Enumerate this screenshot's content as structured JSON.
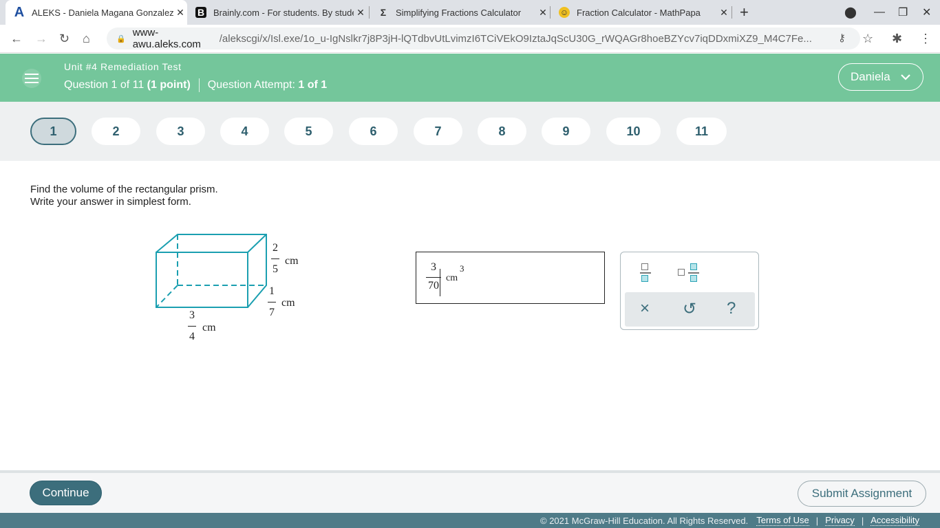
{
  "browser": {
    "tabs": [
      {
        "title": "ALEKS - Daniela Magana Gonzalez",
        "icon": "A",
        "active": true
      },
      {
        "title": "Brainly.com - For students. By students",
        "icon": "B"
      },
      {
        "title": "Simplifying Fractions Calculator",
        "icon": "Σ"
      },
      {
        "title": "Fraction Calculator - MathPapa",
        "icon": "☺"
      }
    ],
    "url_host": "www-awu.aleks.com",
    "url_path": "/alekscgi/x/Isl.exe/1o_u-IgNslkr7j8P3jH-lQTdbvUtLvimzI6TCiVEkO9IztaJqScU30G_rWQAGr8hoeBZYcv7iqDDxmiXZ9_M4C7Fe..."
  },
  "header": {
    "title": "Unit #4 Remediation Test",
    "question_prefix": "Question 1 of 11 ",
    "points": "(1 point)",
    "attempt_label": "Question Attempt: ",
    "attempt_value": "1 of 1",
    "user": "Daniela"
  },
  "questions": [
    "1",
    "2",
    "3",
    "4",
    "5",
    "6",
    "7",
    "8",
    "9",
    "10",
    "11"
  ],
  "current_question": 1,
  "prompt": {
    "line1": "Find the volume of the rectangular prism.",
    "line2": "Write your answer in simplest form."
  },
  "figure": {
    "height": {
      "num": "2",
      "den": "5",
      "unit": "cm"
    },
    "depth": {
      "num": "1",
      "den": "7",
      "unit": "cm"
    },
    "width": {
      "num": "3",
      "den": "4",
      "unit": "cm"
    },
    "color": "#1a9fb0"
  },
  "answer": {
    "num": "3",
    "den": "70",
    "unit": "cm",
    "exp": "3"
  },
  "tools": {
    "clear": "×",
    "undo": "↺",
    "help": "?"
  },
  "footer": {
    "continue": "Continue",
    "submit": "Submit Assignment",
    "copyright": "© 2021 McGraw-Hill Education. All Rights Reserved.",
    "terms": "Terms of Use",
    "privacy": "Privacy",
    "accessibility": "Accessibility",
    "sep": "|"
  }
}
